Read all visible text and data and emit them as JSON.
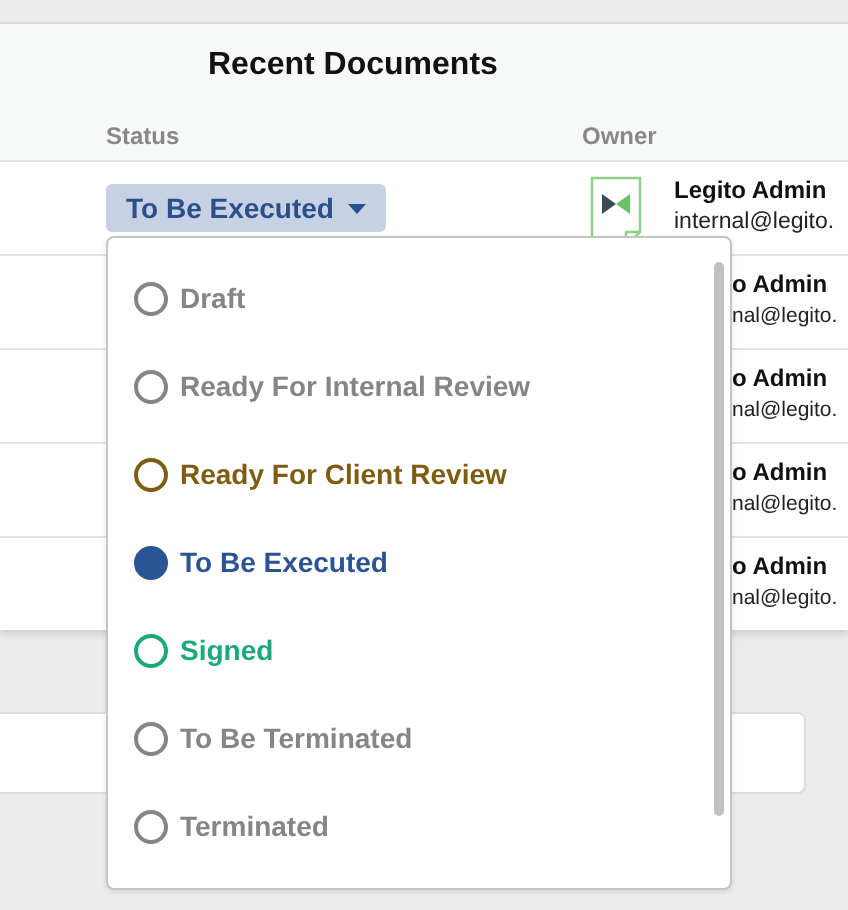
{
  "title": "Recent Documents",
  "columns": [
    "Status",
    "Owner"
  ],
  "rows": [
    {
      "kind": "full",
      "status": "To Be Executed",
      "owner_name": "Legito Admin",
      "owner_email": "internal@legito."
    },
    {
      "kind": "covered",
      "owner_name": "o Admin",
      "owner_email": "nal@legito."
    },
    {
      "kind": "covered",
      "owner_name": "o Admin",
      "owner_email": "nal@legito."
    },
    {
      "kind": "covered",
      "owner_name": "o Admin",
      "owner_email": "nal@legito."
    },
    {
      "kind": "covered",
      "owner_name": "o Admin",
      "owner_email": "nal@legito."
    }
  ],
  "status_menu": {
    "expanded": true,
    "options": [
      {
        "label": "Draft",
        "color": "#858585",
        "selected": false
      },
      {
        "label": "Ready For Internal Review",
        "color": "#858585",
        "selected": false
      },
      {
        "label": "Ready For Client Review",
        "color": "#7e5d10",
        "selected": false
      },
      {
        "label": "To Be Executed",
        "color": "#2b5494",
        "selected": true
      },
      {
        "label": "Signed",
        "color": "#19a97b",
        "selected": false
      },
      {
        "label": "To Be Terminated",
        "color": "#858585",
        "selected": false
      },
      {
        "label": "Terminated",
        "color": "#858585",
        "selected": false
      }
    ]
  }
}
